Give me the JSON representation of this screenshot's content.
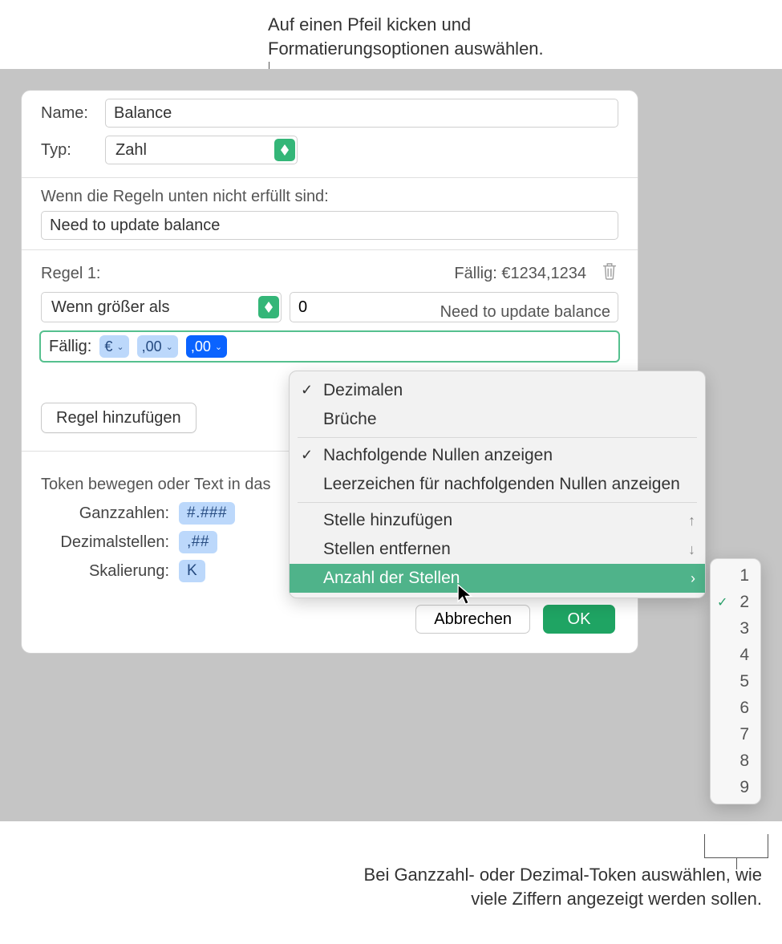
{
  "callouts": {
    "top": "Auf einen Pfeil kicken und Formatierungsoptionen auswählen.",
    "bottom": "Bei Ganzzahl- oder Dezimal-Token auswählen, wie viele Ziffern angezeigt werden sollen."
  },
  "labels": {
    "name": "Name:",
    "type": "Typ:",
    "condition_text": "Wenn die Regeln unten nicht erfüllt sind:",
    "rule_number": "Regel 1:",
    "due_prefix": "Fällig:",
    "add_rule": "Regel hinzufügen",
    "hint": "Token bewegen oder Text in das",
    "integers": "Ganzzahlen:",
    "decimals": "Dezimalstellen:",
    "scaling": "Skalierung:",
    "cancel": "Abbrechen",
    "ok": "OK"
  },
  "values": {
    "name": "Balance",
    "type": "Zahl",
    "condition_preview": "Need to update balance",
    "condition_value": "Need to update balance",
    "rule_preview": "Fällig: €1234,1234",
    "rule_condition": "Wenn größer als",
    "rule_threshold": "0",
    "token_currency": "€",
    "token_decimal_a": ",00",
    "token_decimal_b": ",00",
    "pill_integers": "#.###",
    "pill_decimals": ",##",
    "pill_scaling": "K"
  },
  "menu": {
    "items": [
      {
        "label": "Dezimalen",
        "checked": true
      },
      {
        "label": "Brüche",
        "checked": false
      },
      {
        "sep": true
      },
      {
        "label": "Nachfolgende Nullen anzeigen",
        "checked": true
      },
      {
        "label": "Leerzeichen für nachfolgenden Nullen anzeigen",
        "checked": false
      },
      {
        "sep": true
      },
      {
        "label": "Stelle hinzufügen",
        "arrow": "↑"
      },
      {
        "label": "Stellen entfernen",
        "arrow": "↓"
      },
      {
        "label": "Anzahl der Stellen",
        "arrow": "›",
        "highlight": true
      }
    ]
  },
  "submenu": {
    "items": [
      "1",
      "2",
      "3",
      "4",
      "5",
      "6",
      "7",
      "8",
      "9"
    ],
    "selected": "2"
  }
}
